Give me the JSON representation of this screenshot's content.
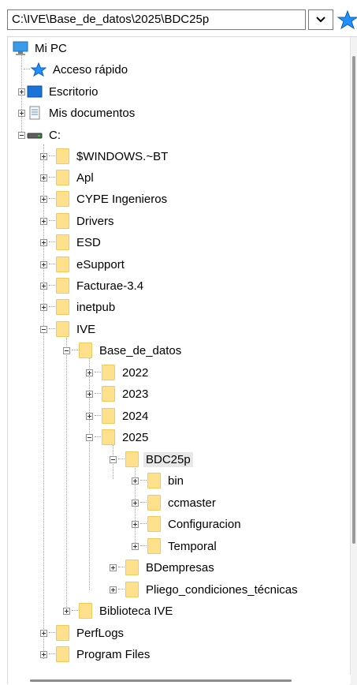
{
  "address_bar": {
    "path": "C:\\IVE\\Base_de_datos\\2025\\BDC25p"
  },
  "tree": {
    "items": [
      {
        "label": "Mi PC",
        "icon": "computer-icon"
      },
      {
        "label": "Acceso rápido",
        "icon": "star-icon"
      },
      {
        "label": "Escritorio",
        "icon": "desktop-icon"
      },
      {
        "label": "Mis documentos",
        "icon": "document-icon"
      },
      {
        "label": "C:",
        "icon": "drive-icon"
      },
      {
        "label": "$WINDOWS.~BT",
        "icon": "folder-icon"
      },
      {
        "label": "Apl",
        "icon": "folder-icon"
      },
      {
        "label": "CYPE Ingenieros",
        "icon": "folder-icon"
      },
      {
        "label": "Drivers",
        "icon": "folder-icon"
      },
      {
        "label": "ESD",
        "icon": "folder-icon"
      },
      {
        "label": "eSupport",
        "icon": "folder-icon"
      },
      {
        "label": "Facturae-3.4",
        "icon": "folder-icon"
      },
      {
        "label": "inetpub",
        "icon": "folder-icon"
      },
      {
        "label": "IVE",
        "icon": "folder-icon"
      },
      {
        "label": "Base_de_datos",
        "icon": "folder-icon"
      },
      {
        "label": "2022",
        "icon": "folder-icon"
      },
      {
        "label": "2023",
        "icon": "folder-icon"
      },
      {
        "label": "2024",
        "icon": "folder-icon"
      },
      {
        "label": "2025",
        "icon": "folder-icon"
      },
      {
        "label": "BDC25p",
        "icon": "folder-icon"
      },
      {
        "label": "bin",
        "icon": "folder-icon"
      },
      {
        "label": "ccmaster",
        "icon": "folder-icon"
      },
      {
        "label": "Configuracion",
        "icon": "folder-icon"
      },
      {
        "label": "Temporal",
        "icon": "folder-icon"
      },
      {
        "label": "BDempresas",
        "icon": "folder-icon"
      },
      {
        "label": "Pliego_condiciones_técnicas",
        "icon": "folder-icon"
      },
      {
        "label": "Biblioteca IVE",
        "icon": "folder-icon"
      },
      {
        "label": "PerfLogs",
        "icon": "folder-icon"
      },
      {
        "label": "Program Files",
        "icon": "folder-icon"
      }
    ]
  },
  "colors": {
    "folder": "#ffe08c",
    "selection": "#e8e8e8",
    "accent_blue": "#1a8ce0"
  }
}
